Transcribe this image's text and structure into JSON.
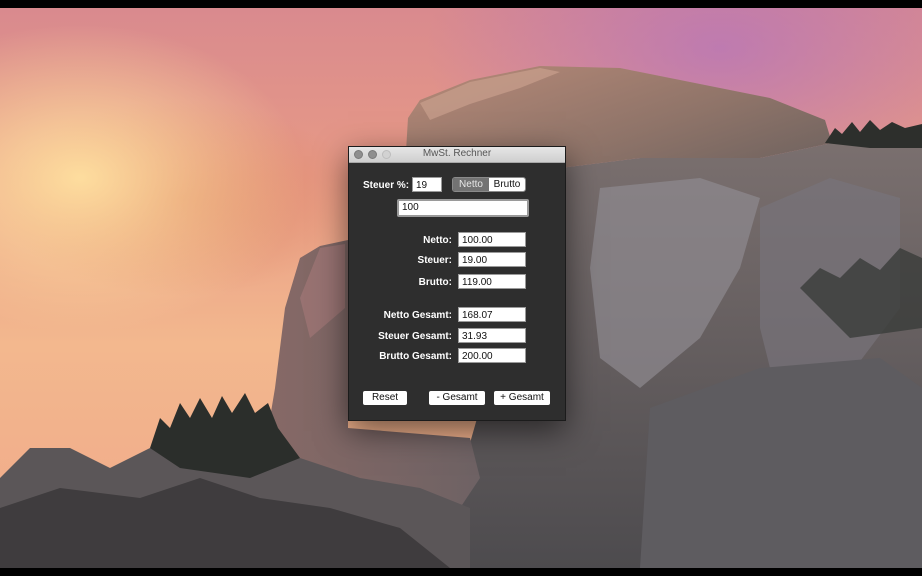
{
  "window": {
    "title": "MwSt. Rechner"
  },
  "tax": {
    "label": "Steuer %:",
    "value": "19",
    "mode_options": [
      "Netto",
      "Brutto"
    ],
    "mode_selected": "Netto"
  },
  "amount": {
    "value": "100"
  },
  "results": [
    {
      "label": "Netto:",
      "value": "100.00"
    },
    {
      "label": "Steuer:",
      "value": "19.00"
    },
    {
      "label": "Brutto:",
      "value": "119.00"
    }
  ],
  "totals": [
    {
      "label": "Netto Gesamt:",
      "value": "168.07"
    },
    {
      "label": "Steuer Gesamt:",
      "value": "31.93"
    },
    {
      "label": "Brutto Gesamt:",
      "value": "200.00"
    }
  ],
  "buttons": {
    "reset": "Reset",
    "minus_total": "- Gesamt",
    "plus_total": "+ Gesamt"
  }
}
